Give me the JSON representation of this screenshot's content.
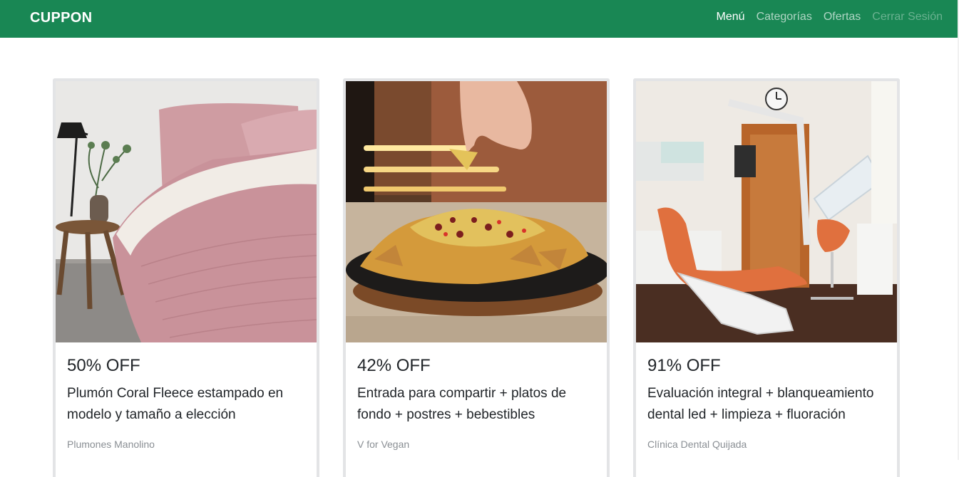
{
  "navbar": {
    "brand": "CUPPON",
    "links": [
      {
        "label": "Menú"
      },
      {
        "label": "Categorías"
      },
      {
        "label": "Ofertas"
      },
      {
        "label": "Cerrar Sesión"
      }
    ]
  },
  "offers": [
    {
      "image": "bed-comforter-photo",
      "discount": "50% OFF",
      "title": "Plumón Coral Fleece estampado en modelo y tamaño a elección",
      "merchant": "Plumones Manolino"
    },
    {
      "image": "nachos-platter-photo",
      "discount": "42% OFF",
      "title": "Entrada para compartir + platos de fondo + postres + bebestibles",
      "merchant": "V for Vegan"
    },
    {
      "image": "dental-clinic-photo",
      "discount": "91% OFF",
      "title": "Evaluación integral + blanqueamiento dental led + limpieza + fluoración",
      "merchant": "Clínica Dental Quijada"
    }
  ],
  "colors": {
    "navbar_bg": "#198754",
    "nav_text_active": "#ffffff",
    "nav_text_muted": "rgba(255,255,255,0.65)",
    "card_border": "#e3e4e6",
    "merchant_text": "#8a8f94"
  }
}
